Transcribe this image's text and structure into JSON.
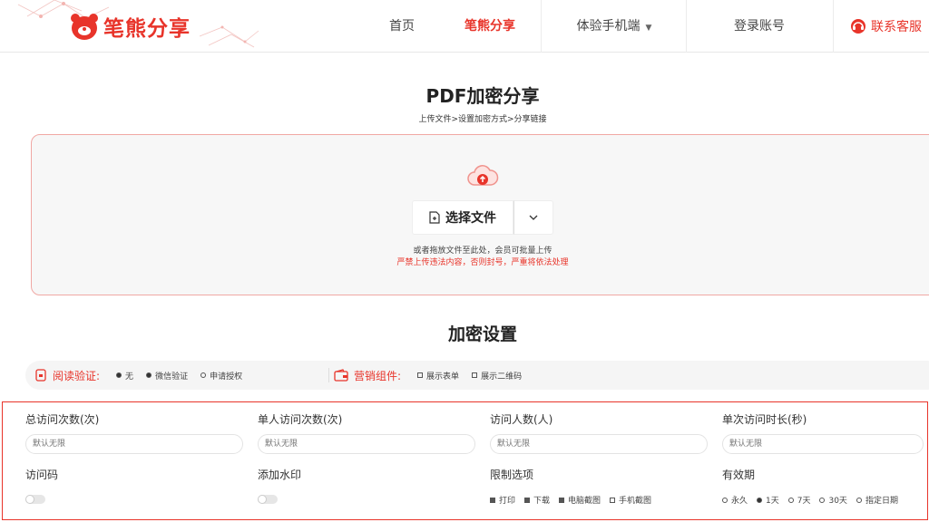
{
  "header": {
    "logo_text": "笔熊分享",
    "nav": [
      {
        "label": "首页"
      },
      {
        "label": "笔熊分享"
      },
      {
        "label": "体验手机端"
      },
      {
        "label": "登录账号"
      }
    ],
    "contact_label": "联系客服",
    "accent": "#e8342a"
  },
  "upload": {
    "title": "PDF加密分享",
    "steps": "上传文件>设置加密方式>分享链接",
    "select_label": "选择文件",
    "hint": "或者拖放文件至此处，会员可批量上传",
    "warning": "严禁上传违法内容，否则封号，严重将依法处理"
  },
  "settings": {
    "title": "加密设置",
    "read_verify": {
      "label": "阅读验证:",
      "options": [
        "无",
        "微信验证",
        "申请授权"
      ],
      "selected": "微信验证"
    },
    "marketing": {
      "label": "营销组件:",
      "options": [
        "展示表单",
        "展示二维码"
      ]
    },
    "fields": {
      "total_visits": {
        "label": "总访问次数(次)",
        "placeholder": "默认无限"
      },
      "single_visits": {
        "label": "单人访问次数(次)",
        "placeholder": "默认无限"
      },
      "visitors": {
        "label": "访问人数(人)",
        "placeholder": "默认无限"
      },
      "duration": {
        "label": "单次访问时长(秒)",
        "placeholder": "默认无限"
      },
      "access_code": {
        "label": "访问码"
      },
      "watermark": {
        "label": "添加水印"
      },
      "restrict": {
        "label": "限制选项",
        "options": [
          "打印",
          "下载",
          "电脑截图",
          "手机截图"
        ],
        "checked": [
          "打印",
          "下载",
          "电脑截图"
        ]
      },
      "validity": {
        "label": "有效期",
        "options": [
          "永久",
          "1天",
          "7天",
          "30天",
          "指定日期"
        ],
        "selected": "1天"
      }
    }
  }
}
